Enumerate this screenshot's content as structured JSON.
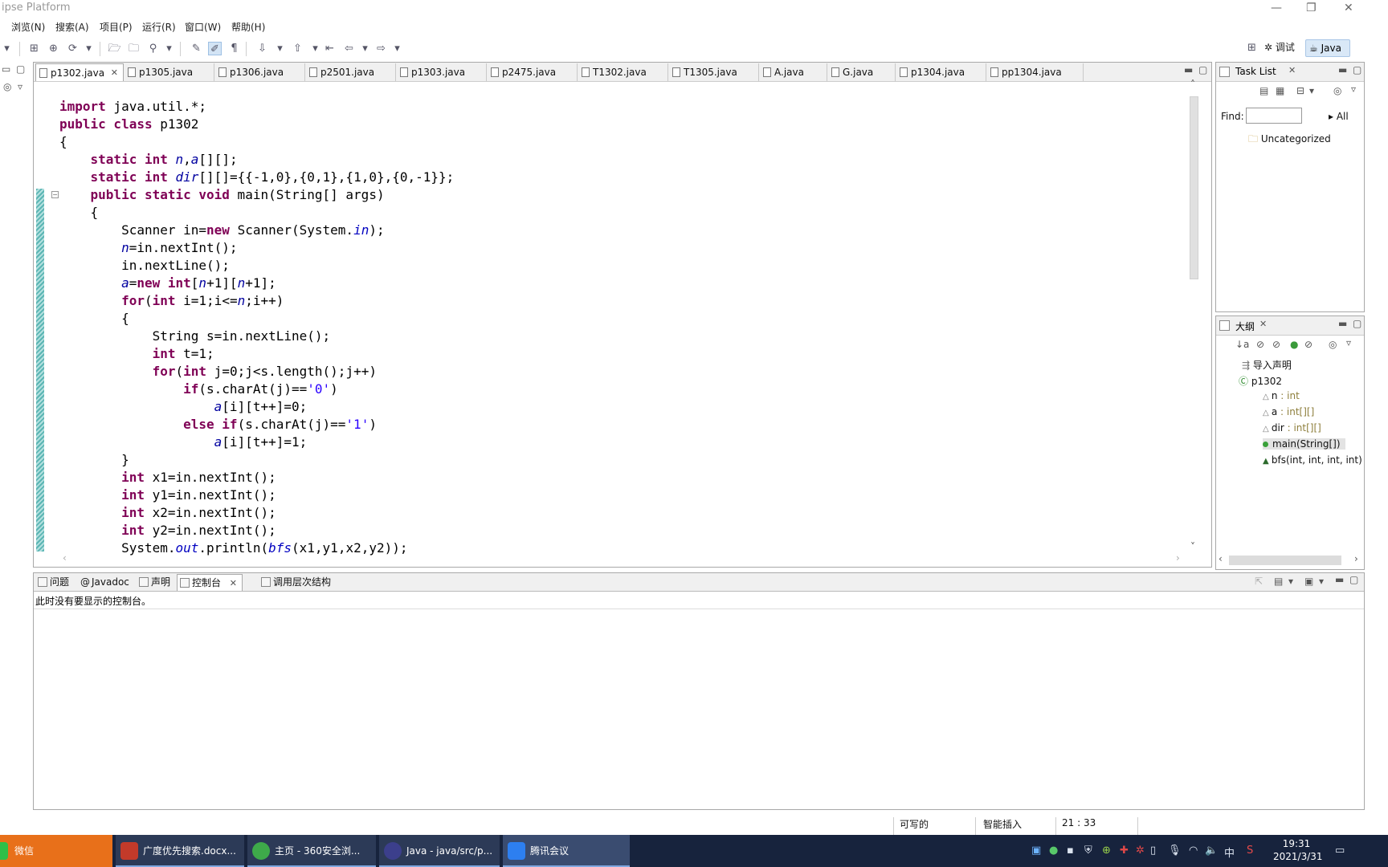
{
  "window": {
    "title": "ipse Platform"
  },
  "menu": [
    "浏览(N)",
    "搜索(A)",
    "项目(P)",
    "运行(R)",
    "窗口(W)",
    "帮助(H)"
  ],
  "perspectives": {
    "debug": "调试",
    "java": "Java"
  },
  "editor": {
    "tabs": [
      {
        "label": "p1302.java",
        "active": true
      },
      {
        "label": "p1305.java"
      },
      {
        "label": "p1306.java"
      },
      {
        "label": "p2501.java"
      },
      {
        "label": "p1303.java"
      },
      {
        "label": "p2475.java"
      },
      {
        "label": "T1302.java"
      },
      {
        "label": "T1305.java"
      },
      {
        "label": "A.java"
      },
      {
        "label": "G.java"
      },
      {
        "label": "p1304.java"
      },
      {
        "label": "pp1304.java"
      }
    ]
  },
  "tasklist": {
    "title": "Task List",
    "find_label": "Find:",
    "all_label": "All",
    "category": "Uncategorized"
  },
  "outline": {
    "title": "大纲",
    "imports": "导入声明",
    "class": "p1302",
    "members": [
      {
        "name": "n",
        "type": " : int"
      },
      {
        "name": "a",
        "type": " : int[][]"
      },
      {
        "name": "dir",
        "type": " : int[][]"
      },
      {
        "name": "main(String[])",
        "type": ""
      },
      {
        "name": "bfs(int, int, int, int)",
        "type": ""
      }
    ]
  },
  "console": {
    "tabs": [
      "问题",
      "Javadoc",
      "声明",
      "控制台",
      "调用层次结构"
    ],
    "message": "此时没有要显示的控制台。"
  },
  "status": {
    "writable": "可写的",
    "insert_mode": "智能插入",
    "position": "21 : 33"
  },
  "taskbar": {
    "items": [
      "微信",
      "广度优先搜索.docx...",
      "主页 - 360安全浏...",
      "Java - java/src/p...",
      "腾讯会议"
    ],
    "ime": "中",
    "time": "19:31",
    "date": "2021/3/31"
  },
  "colors": {
    "keyword": "#7f0055",
    "field": "#0000a0",
    "string": "#2a00ff",
    "taskbar": "#17233d"
  }
}
